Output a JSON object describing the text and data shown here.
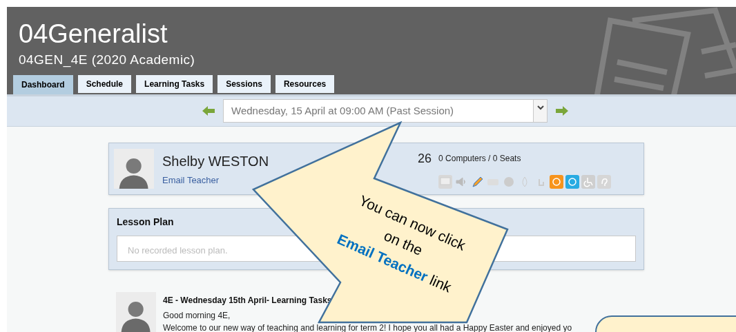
{
  "header": {
    "title": "04Generalist",
    "subtitle": "04GEN_4E (2020 Academic)"
  },
  "tabs": [
    {
      "label": "Dashboard",
      "selected": true
    },
    {
      "label": "Schedule",
      "selected": false
    },
    {
      "label": "Learning Tasks",
      "selected": false
    },
    {
      "label": "Sessions",
      "selected": false
    },
    {
      "label": "Resources",
      "selected": false
    }
  ],
  "session_picker": {
    "value": "Wednesday, 15 April at 09:00 AM (Past Session)"
  },
  "teacher_card": {
    "name": "Shelby WESTON",
    "link": "Email Teacher",
    "room": "26",
    "facilities": "0 Computers / 0 Seats"
  },
  "lesson_plan": {
    "title": "Lesson Plan",
    "placeholder": "No recorded lesson plan."
  },
  "post": {
    "title": "4E - Wednesday 15th April- Learning Tasks",
    "lines": [
      "Good morning 4E,",
      "Welcome to our new way of teaching and learning for term 2! I hope you all had a Happy Easter and enjoyed yo"
    ]
  },
  "callout": {
    "lines": [
      "You can now click",
      "on the",
      "**Email Teacher** link"
    ]
  }
}
